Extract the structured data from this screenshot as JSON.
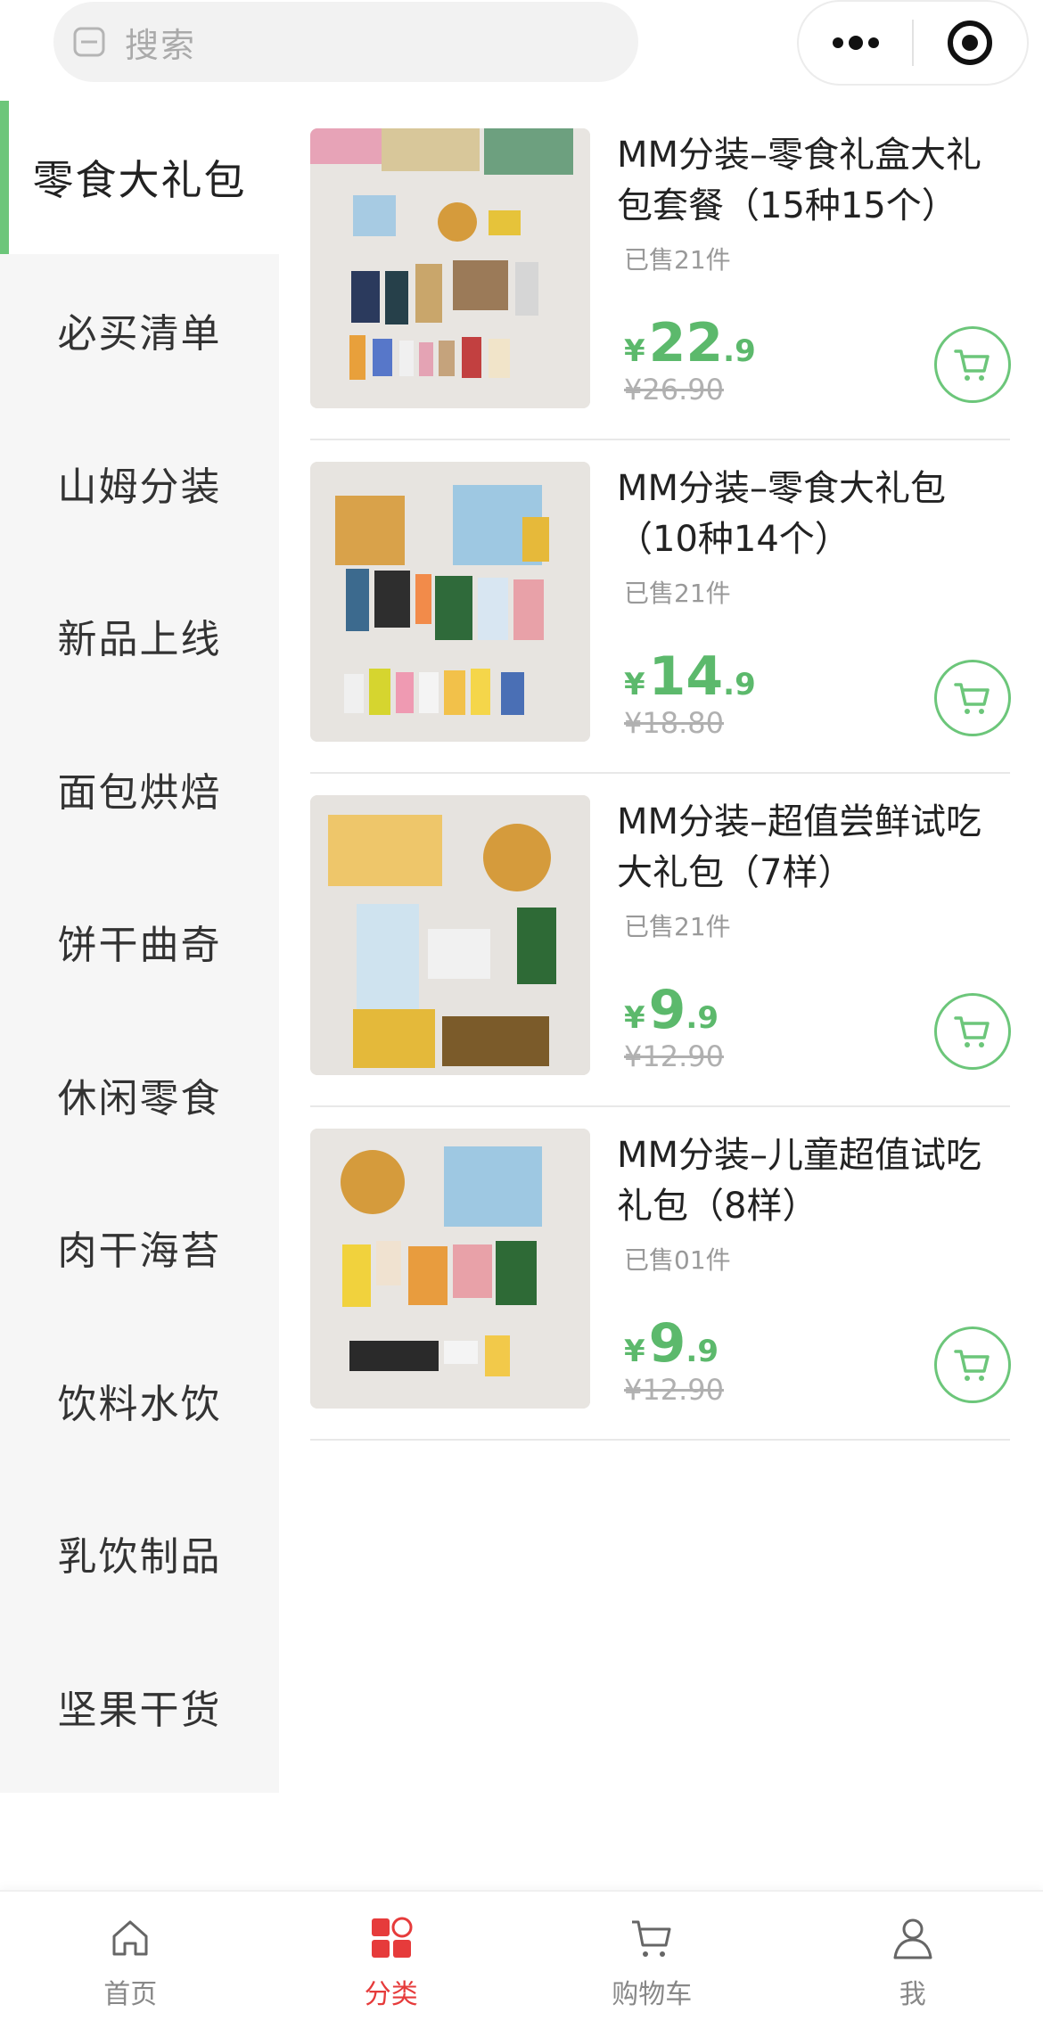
{
  "search": {
    "placeholder": "搜索"
  },
  "capsule": {
    "more_icon": "more-dots-icon",
    "close_icon": "target-close-icon"
  },
  "colors": {
    "accent": "#6cc67a",
    "price": "#5cb96c",
    "tab_active": "#e63b3b"
  },
  "sidebar": {
    "active_index": 0,
    "items": [
      {
        "label": "零食大礼包"
      },
      {
        "label": "必买清单"
      },
      {
        "label": "山姆分装"
      },
      {
        "label": "新品上线"
      },
      {
        "label": "面包烘焙"
      },
      {
        "label": "饼干曲奇"
      },
      {
        "label": "休闲零食"
      },
      {
        "label": "肉干海苔"
      },
      {
        "label": "饮料水饮"
      },
      {
        "label": "乳饮制品"
      },
      {
        "label": "坚果干货"
      }
    ]
  },
  "products": [
    {
      "title": "MM分装–零食礼盒大礼包套餐（15种15个）",
      "sold": "已售21件",
      "currency": "¥",
      "price_int": "22",
      "price_dec": ".9",
      "original_price": "¥26.90"
    },
    {
      "title": "MM分装–零食大礼包（10种14个）",
      "sold": "已售21件",
      "currency": "¥",
      "price_int": "14",
      "price_dec": ".9",
      "original_price": "¥18.80"
    },
    {
      "title": "MM分装–超值尝鲜试吃大礼包（7样）",
      "sold": "已售21件",
      "currency": "¥",
      "price_int": "9",
      "price_dec": ".9",
      "original_price": "¥12.90"
    },
    {
      "title": "MM分装–儿童超值试吃礼包（8样）",
      "sold": "已售01件",
      "currency": "¥",
      "price_int": "9",
      "price_dec": ".9",
      "original_price": "¥12.90"
    }
  ],
  "tabbar": {
    "active_index": 1,
    "items": [
      {
        "label": "首页",
        "icon": "home-icon"
      },
      {
        "label": "分类",
        "icon": "category-icon"
      },
      {
        "label": "购物车",
        "icon": "cart-icon"
      },
      {
        "label": "我",
        "icon": "user-icon"
      }
    ]
  }
}
